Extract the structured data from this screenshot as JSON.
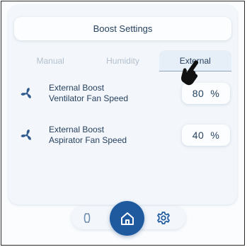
{
  "header": {
    "title": "Boost Settings"
  },
  "tabs": [
    {
      "label": "Manual",
      "active": false
    },
    {
      "label": "Humidity",
      "active": false
    },
    {
      "label": "External",
      "active": true
    }
  ],
  "settings": [
    {
      "label_line1": "External Boost",
      "label_line2": "Ventilator Fan Speed",
      "value": "80",
      "unit": "%",
      "icon": "fan-icon"
    },
    {
      "label_line1": "External Boost",
      "label_line2": "Aspirator Fan Speed",
      "value": "40",
      "unit": "%",
      "icon": "fan-icon"
    }
  ],
  "nav": {
    "items": [
      {
        "icon": "wind-icon"
      },
      {
        "icon": "home-icon",
        "active": true
      },
      {
        "icon": "gear-icon"
      }
    ]
  },
  "colors": {
    "accent": "#1f5a9e",
    "text": "#27415f",
    "muted": "#b4bfcc",
    "icon": "#2f5b8e"
  }
}
